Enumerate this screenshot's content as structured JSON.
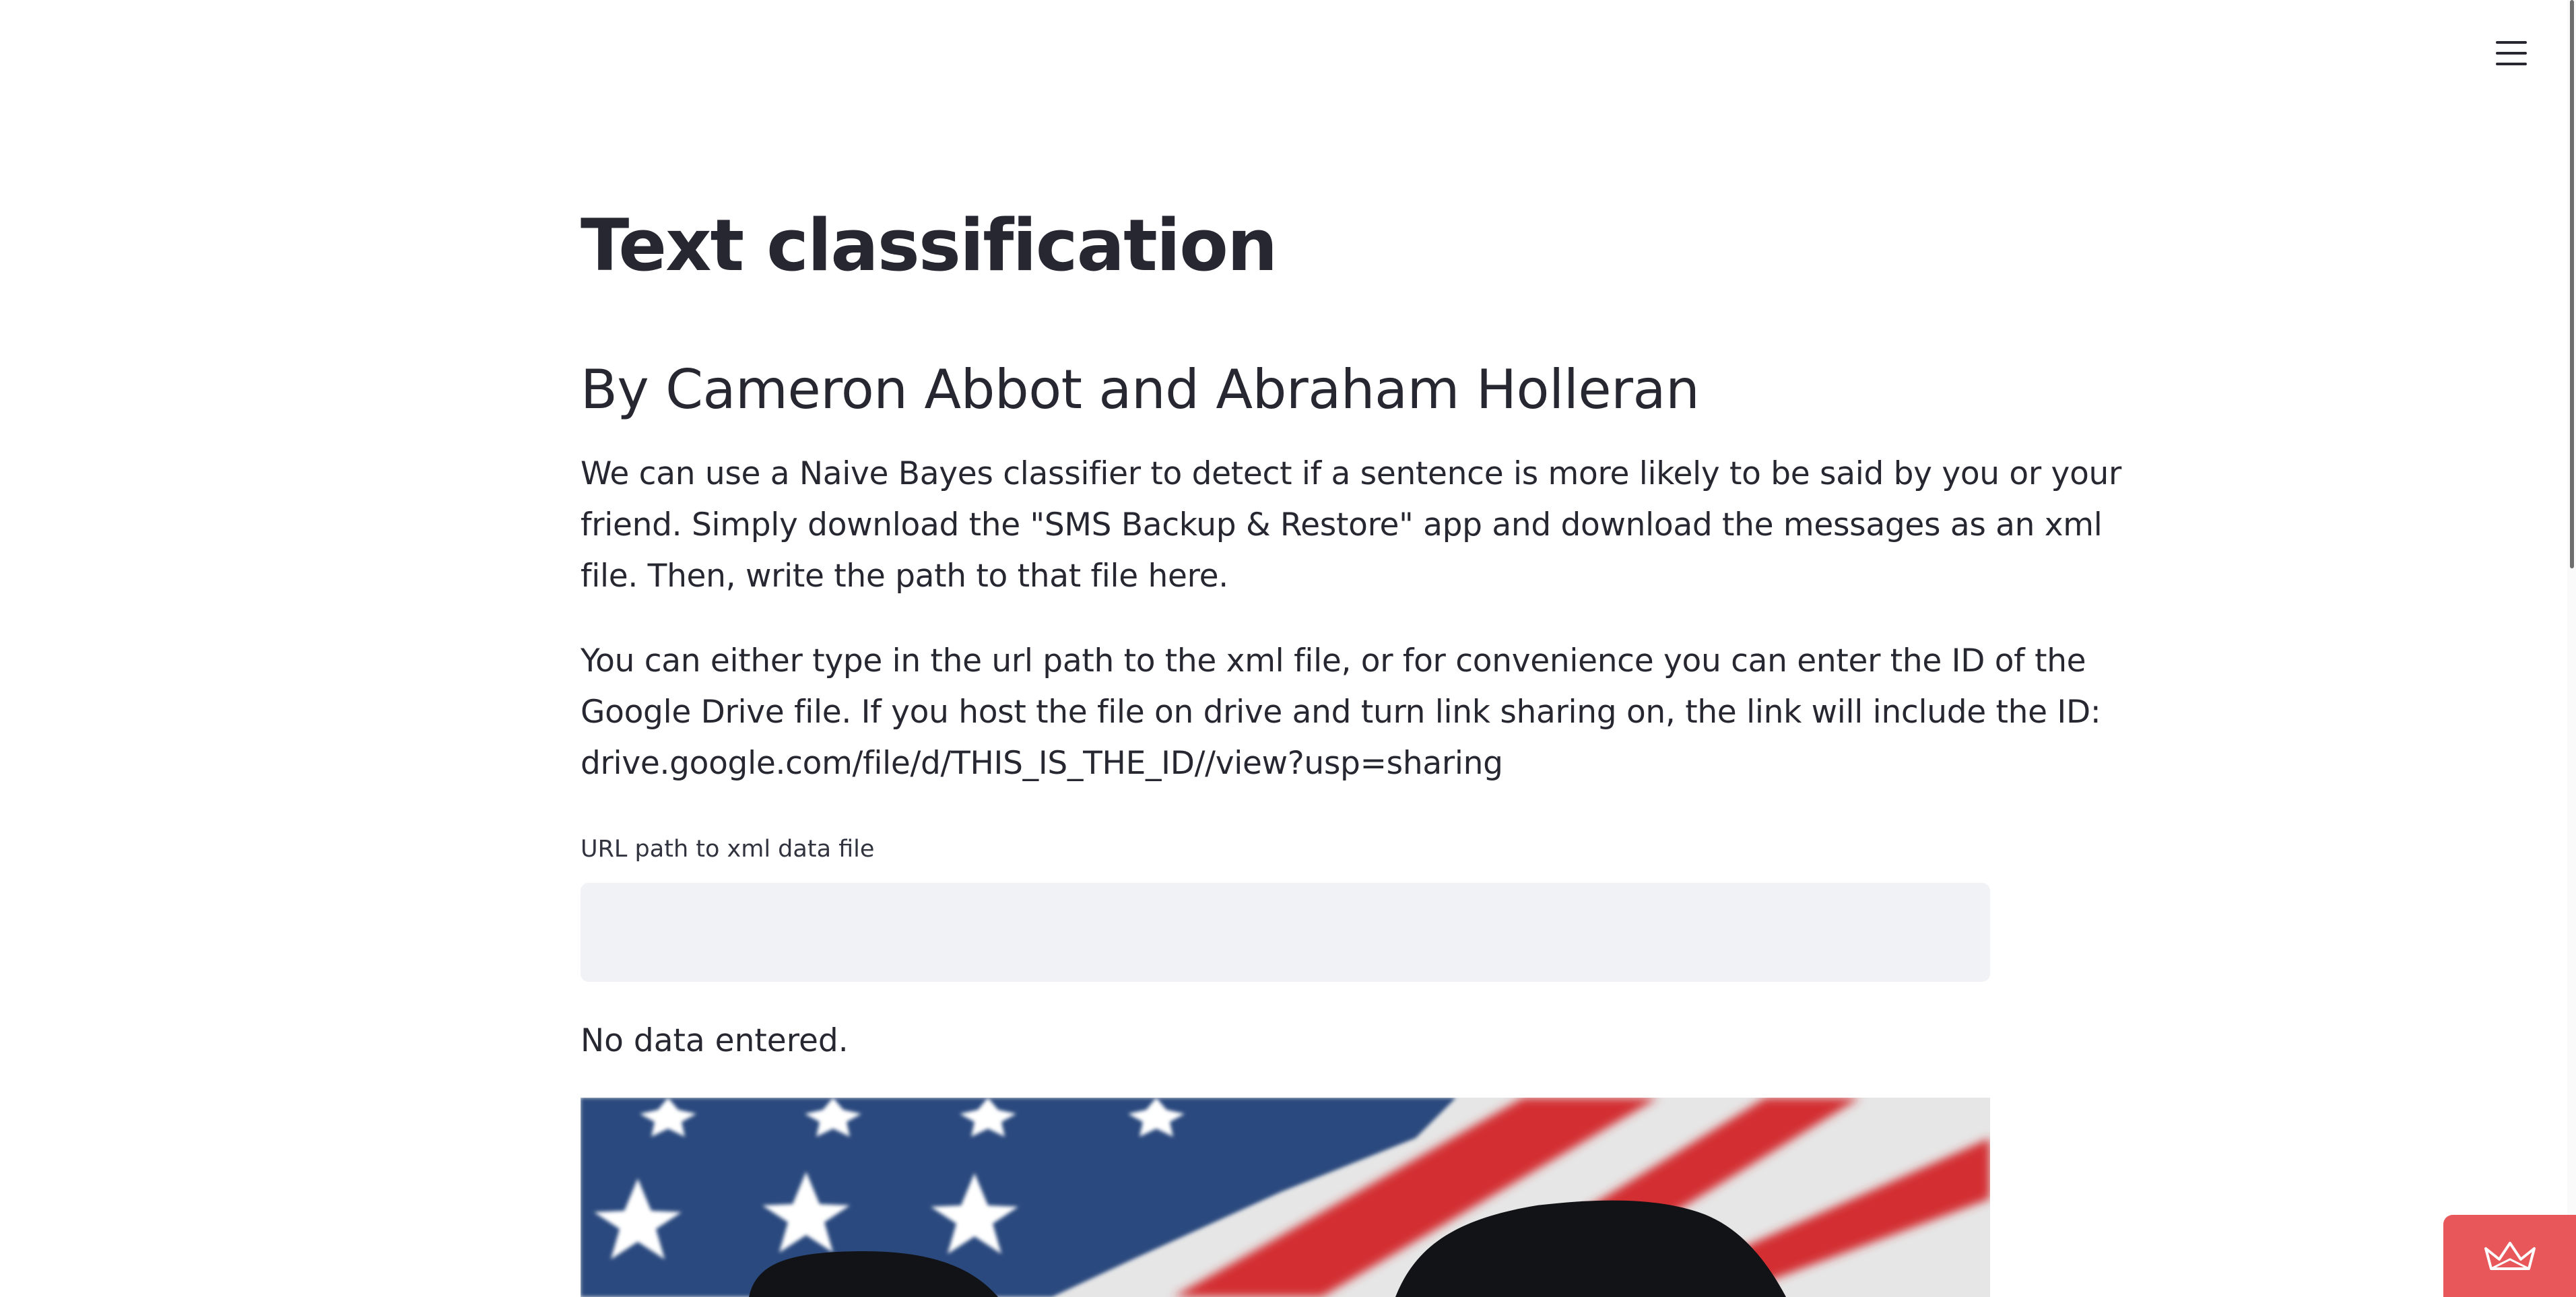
{
  "page": {
    "title": "Text classification",
    "subtitle": "By Cameron Abbot and Abraham Holleran",
    "intro_lines": [
      "We can use a Naive Bayes classifier to detect if a sentence is more likely to be said by you or your",
      "friend. Simply download the \"SMS Backup & Restore\" app and download the messages as an xml",
      "file. Then, write the path to that file here."
    ],
    "instructions_lines": [
      "You can either type in the url path to the xml file, or for convenience you can enter the ID of the",
      "Google Drive file. If you host the file on drive and turn link sharing on, the link will include the ID:",
      "drive.google.com/file/d/THIS_IS_THE_ID//view?usp=sharing"
    ]
  },
  "url_field": {
    "label": "URL path to xml data file",
    "value": "",
    "placeholder": ""
  },
  "status_text": "No data entered.",
  "icons": {
    "menu": "hamburger-menu-icon",
    "badge": "crown-icon",
    "image": "american-flag-image"
  },
  "colors": {
    "text": "#262730",
    "input_bg": "#f0f2f6",
    "badge_bg": "#e8575a",
    "flag_blue": "#2c4a7e",
    "flag_red": "#d32f32",
    "flag_white": "#e9e9e9"
  }
}
